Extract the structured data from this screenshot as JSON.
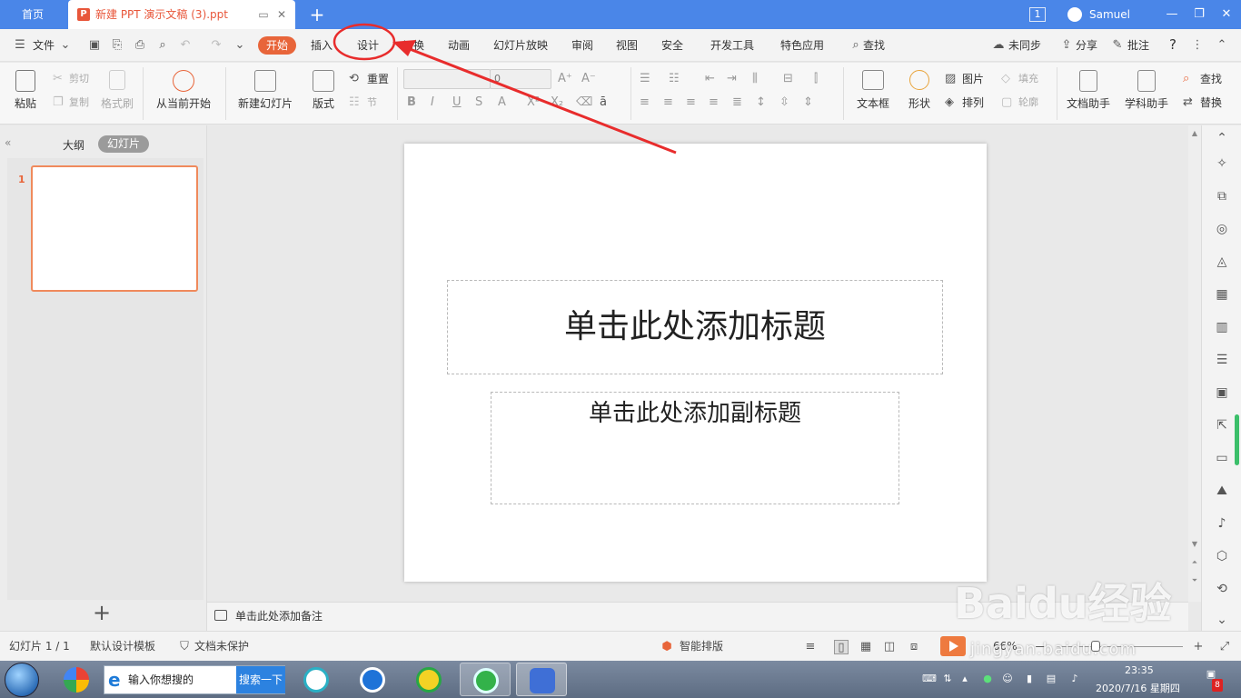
{
  "tabbar": {
    "home_label": "首页",
    "doc_badge": "P",
    "doc_title": "新建 PPT 演示文稿 (3).ppt",
    "add_label": "+",
    "window_count": "1",
    "user_name": "Samuel"
  },
  "menubar": {
    "file_label": "文件",
    "tabs": [
      "开始",
      "插入",
      "设计",
      "切换",
      "动画",
      "幻灯片放映",
      "审阅",
      "视图",
      "安全",
      "开发工具",
      "特色应用"
    ],
    "search_label": "查找",
    "sync_label": "未同步",
    "share_label": "分享",
    "comment_label": "批注",
    "help_label": "?"
  },
  "ribbon": {
    "paste_label": "粘贴",
    "cut_label": "剪切",
    "copy_label": "复制",
    "format_painter_label": "格式刷",
    "play_from_current_label": "从当前开始",
    "new_slide_label": "新建幻灯片",
    "layout_label": "版式",
    "reset_label": "重置",
    "section_label": "节",
    "font_size_value": "0",
    "textbox_label": "文本框",
    "shape_label": "形状",
    "picture_label": "图片",
    "arrange_label": "排列",
    "fill_label": "填充",
    "outline_label": "轮廓",
    "doc_assistant_label": "文档助手",
    "subject_assistant_label": "学科助手",
    "find_label": "查找",
    "replace_label": "替换"
  },
  "left_pane": {
    "outline_tab": "大纲",
    "slides_tab": "幻灯片",
    "slide_number": "1"
  },
  "slide": {
    "title_placeholder": "单击此处添加标题",
    "subtitle_placeholder": "单击此处添加副标题"
  },
  "notes": {
    "placeholder": "单击此处添加备注"
  },
  "statusbar": {
    "slide_count": "幻灯片 1 / 1",
    "template": "默认设计模板",
    "protection": "文档未保护",
    "smart_layout": "智能排版",
    "zoom": "66%"
  },
  "taskbar": {
    "search_placeholder": "输入你想搜的",
    "search_button": "搜索一下",
    "time": "23:35",
    "date": "2020/7/16 星期四",
    "badge_count": "8"
  },
  "watermark": {
    "logo": "Baidu经验",
    "url": "jingyan.baidu.com"
  },
  "colors": {
    "accent": "#e8653a",
    "tabbar": "#4a86e8",
    "annotation": "#e82c2c"
  }
}
